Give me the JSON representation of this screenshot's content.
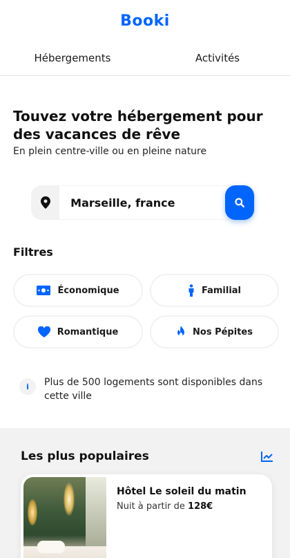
{
  "brand": {
    "logo": "Booki",
    "accent": "#0065fc"
  },
  "tabs": [
    {
      "label": "Hébergements"
    },
    {
      "label": "Activités"
    }
  ],
  "hero": {
    "title": "Touvez votre hébergement pour des vacances de rêve",
    "subtitle": "En plein centre-ville ou en pleine nature"
  },
  "search": {
    "value": "Marseille, france",
    "pin_icon": "location-pin-icon",
    "button_icon": "search-icon"
  },
  "filters": {
    "title": "Filtres",
    "items": [
      {
        "label": "Économique",
        "icon": "money-icon"
      },
      {
        "label": "Familial",
        "icon": "person-icon"
      },
      {
        "label": "Romantique",
        "icon": "heart-icon"
      },
      {
        "label": "Nos Pépites",
        "icon": "fire-icon"
      }
    ]
  },
  "info": {
    "icon_glyph": "i",
    "text": "Plus de 500 logements sont disponibles dans cette ville"
  },
  "popular": {
    "title": "Les plus populaires",
    "trend_icon": "trend-chart-icon",
    "cards": [
      {
        "name": "Hôtel Le soleil du matin",
        "price_prefix": "Nuit à partir de ",
        "price": "128€"
      }
    ]
  }
}
